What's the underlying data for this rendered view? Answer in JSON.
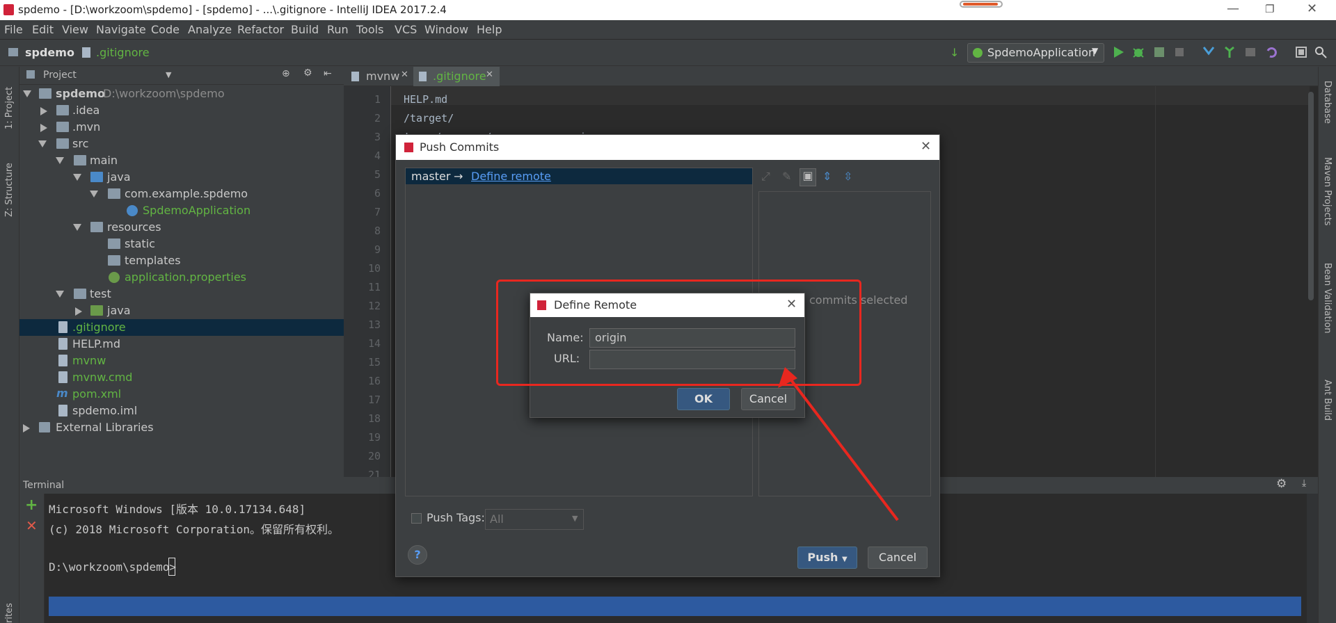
{
  "window": {
    "title": "spdemo - [D:\\workzoom\\spdemo] - [spdemo] - ...\\.gitignore - IntelliJ IDEA 2017.2.4"
  },
  "menu": [
    "File",
    "Edit",
    "View",
    "Navigate",
    "Code",
    "Analyze",
    "Refactor",
    "Build",
    "Run",
    "Tools",
    "VCS",
    "Window",
    "Help"
  ],
  "navbar": {
    "project": "spdemo",
    "file": ".gitignore",
    "run_config": "SpdemoApplication"
  },
  "left_strip": {
    "project": "1: Project",
    "structure": "Z: Structure",
    "favorites": "rites"
  },
  "right_strip": {
    "database": "Database",
    "maven": "Maven Projects",
    "bean": "Bean Validation",
    "ant": "Ant Build"
  },
  "project_panel": {
    "header": "Project",
    "tree": [
      {
        "label": "spdemo",
        "extra": "D:\\workzoom\\spdemo"
      },
      {
        "label": ".idea"
      },
      {
        "label": ".mvn"
      },
      {
        "label": "src"
      },
      {
        "label": "main"
      },
      {
        "label": "java"
      },
      {
        "label": "com.example.spdemo"
      },
      {
        "label": "SpdemoApplication"
      },
      {
        "label": "resources"
      },
      {
        "label": "static"
      },
      {
        "label": "templates"
      },
      {
        "label": "application.properties"
      },
      {
        "label": "test"
      },
      {
        "label": "java"
      },
      {
        "label": ".gitignore"
      },
      {
        "label": "HELP.md"
      },
      {
        "label": "mvnw"
      },
      {
        "label": "mvnw.cmd"
      },
      {
        "label": "pom.xml"
      },
      {
        "label": "spdemo.iml"
      },
      {
        "label": "External Libraries"
      }
    ]
  },
  "editor": {
    "tabs": [
      {
        "label": "mvnw"
      },
      {
        "label": ".gitignore"
      }
    ],
    "line_numbers": [
      "1",
      "2",
      "3",
      "4",
      "5",
      "6",
      "7",
      "8",
      "9",
      "10",
      "11",
      "12",
      "13",
      "14",
      "15",
      "16",
      "17",
      "18",
      "19",
      "20",
      "21"
    ],
    "lines": [
      "HELP.md",
      "/target/",
      "!.mvn/wrapper/maven-wrapper.jar"
    ]
  },
  "terminal": {
    "title": "Terminal",
    "lines": [
      "Microsoft Windows [版本 10.0.17134.648]",
      "(c) 2018 Microsoft Corporation。保留所有权利。",
      "",
      "D:\\workzoom\\spdemo>"
    ]
  },
  "push_dialog": {
    "title": "Push Commits",
    "branch": "master",
    "arrow": "→",
    "define_remote_link": "Define remote",
    "empty_text": "commits selected",
    "push_tags_label": "Push Tags:",
    "push_tags_value": "All",
    "push_button": "Push",
    "cancel_button": "Cancel",
    "help": "?"
  },
  "define_remote": {
    "title": "Define Remote",
    "name_label": "Name:",
    "name_value": "origin",
    "url_label": "URL:",
    "url_value": "",
    "ok_button": "OK",
    "cancel_button": "Cancel"
  },
  "colors": {
    "annotation": "#e8271f",
    "link": "#589df6",
    "green_text": "#62b543",
    "selection": "#0d293e"
  }
}
